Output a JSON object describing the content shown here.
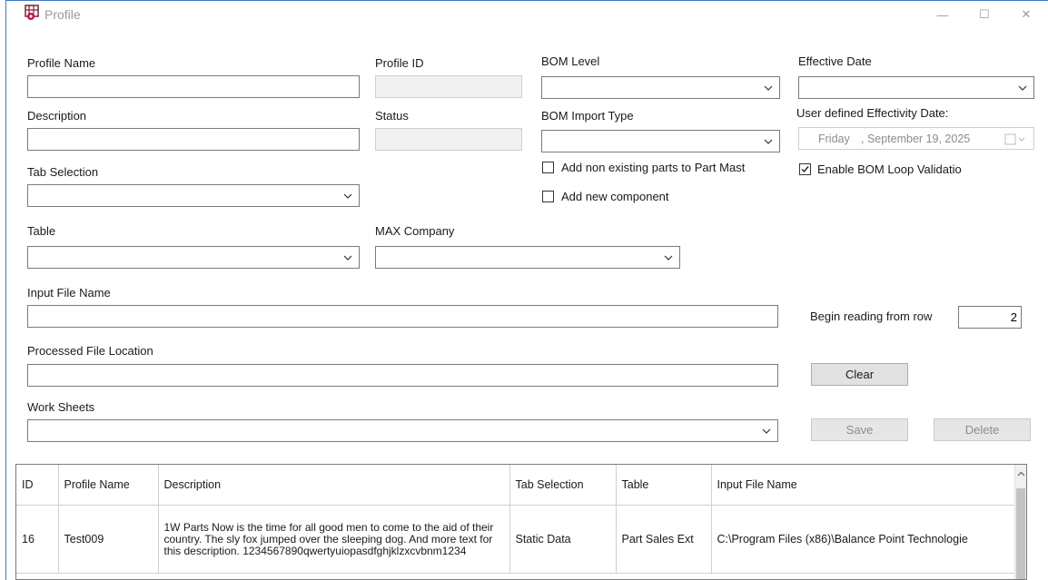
{
  "window": {
    "title": "Profile",
    "controls": {
      "minimize": "—",
      "maximize": "☐",
      "close": "✕"
    }
  },
  "form": {
    "profile_name": {
      "label": "Profile Name",
      "value": ""
    },
    "profile_id": {
      "label": "Profile ID",
      "value": ""
    },
    "bom_level": {
      "label": "BOM Level",
      "value": ""
    },
    "effective_date": {
      "label": "Effective Date",
      "value": ""
    },
    "description": {
      "label": "Description",
      "value": ""
    },
    "status": {
      "label": "Status",
      "value": ""
    },
    "bom_import_type": {
      "label": "BOM Import Type",
      "value": ""
    },
    "user_defined_date": {
      "label": "User defined Effectivity Date:",
      "day": "Friday",
      "date": ", September 19, 2025"
    },
    "tab_selection": {
      "label": "Tab Selection",
      "value": ""
    },
    "add_non_existing": {
      "label": "Add non existing parts to Part Mast",
      "checked": false
    },
    "add_new_component": {
      "label": "Add  new component",
      "checked": false
    },
    "enable_bom_loop": {
      "label": "Enable  BOM  Loop Validatio",
      "checked": true
    },
    "table": {
      "label": "Table",
      "value": ""
    },
    "max_company": {
      "label": "MAX Company",
      "value": ""
    },
    "input_file_name": {
      "label": "Input File Name",
      "value": ""
    },
    "begin_reading": {
      "label": "Begin reading from row",
      "value": "2"
    },
    "processed_file_location": {
      "label": "Processed File Location",
      "value": ""
    },
    "work_sheets": {
      "label": "Work Sheets",
      "value": ""
    }
  },
  "buttons": {
    "clear": "Clear",
    "save": "Save",
    "delete": "Delete"
  },
  "grid": {
    "columns": [
      "ID",
      "Profile Name",
      "Description",
      "Tab Selection",
      "Table",
      "Input File Name"
    ],
    "rows": [
      {
        "id": "16",
        "profile_name": "Test009",
        "description": "1W Parts  Now is the time for all good men to come to the aid of their country.  The sly fox jumped over the sleeping dog. And more text for this description. 1234567890qwertyuiopasdfghjklzxcvbnm1234",
        "tab_selection": "Static Data",
        "table": "Part Sales Ext",
        "input_file_name": "C:\\Program Files (x86)\\Balance Point Technologie"
      }
    ]
  }
}
